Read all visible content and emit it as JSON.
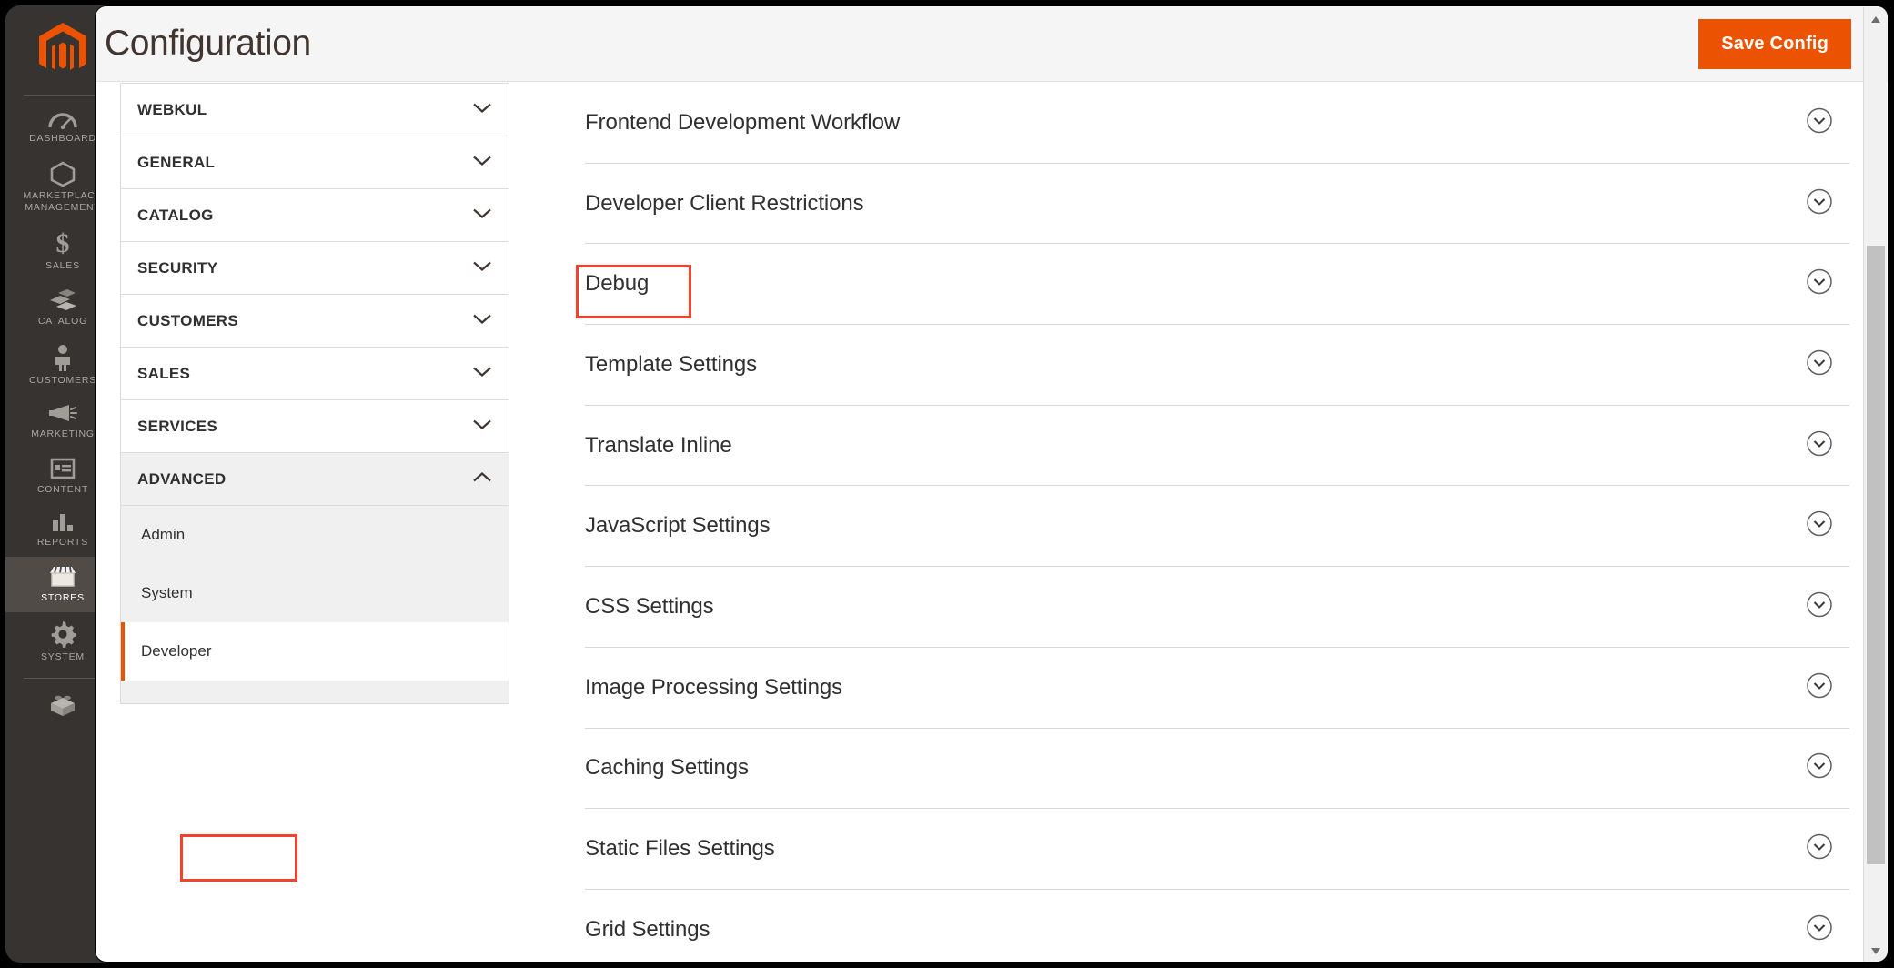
{
  "colors": {
    "brand_orange": "#eb5202",
    "annotation_red": "#f4412e",
    "sidebar_dark": "#373330",
    "sidebar_active": "#514b47",
    "header_bg": "#f5f5f5",
    "text_dark": "#303030"
  },
  "admin_sidebar": {
    "logo_name": "magento-logo",
    "items": [
      {
        "label": "Dashboard",
        "icon": "dashboard-gauge-icon",
        "active": false
      },
      {
        "label": "Marketplace Management",
        "icon": "hexagon-outline-icon",
        "active": false
      },
      {
        "label": "Sales",
        "icon": "dollar-sign-icon",
        "active": false
      },
      {
        "label": "Catalog",
        "icon": "box-stack-icon",
        "active": false
      },
      {
        "label": "Customers",
        "icon": "person-icon",
        "active": false
      },
      {
        "label": "Marketing",
        "icon": "megaphone-icon",
        "active": false
      },
      {
        "label": "Content",
        "icon": "layout-panels-icon",
        "active": false
      },
      {
        "label": "Reports",
        "icon": "bar-chart-icon",
        "active": false
      },
      {
        "label": "Stores",
        "icon": "storefront-awning-icon",
        "active": true
      },
      {
        "label": "System",
        "icon": "gear-icon",
        "active": false
      }
    ],
    "footer_item": {
      "label": "",
      "icon": "lego-brick-icon"
    }
  },
  "header": {
    "title": "Configuration",
    "save_label": "Save Config"
  },
  "config_nav": {
    "sections": [
      {
        "label": "WEBKUL",
        "expanded": false,
        "chevron": "chevron-down-icon"
      },
      {
        "label": "GENERAL",
        "expanded": false,
        "chevron": "chevron-down-icon"
      },
      {
        "label": "CATALOG",
        "expanded": false,
        "chevron": "chevron-down-icon"
      },
      {
        "label": "SECURITY",
        "expanded": false,
        "chevron": "chevron-down-icon"
      },
      {
        "label": "CUSTOMERS",
        "expanded": false,
        "chevron": "chevron-down-icon"
      },
      {
        "label": "SALES",
        "expanded": false,
        "chevron": "chevron-down-icon"
      },
      {
        "label": "SERVICES",
        "expanded": false,
        "chevron": "chevron-down-icon"
      },
      {
        "label": "ADVANCED",
        "expanded": true,
        "chevron": "chevron-up-icon",
        "children": [
          {
            "label": "Admin",
            "active": false
          },
          {
            "label": "System",
            "active": false
          },
          {
            "label": "Developer",
            "active": true,
            "annotated": true
          }
        ]
      }
    ]
  },
  "config_content": {
    "sections": [
      {
        "label": "Frontend Development Workflow",
        "chevron": "chevron-down-circle-icon",
        "annotated": false
      },
      {
        "label": "Developer Client Restrictions",
        "chevron": "chevron-down-circle-icon",
        "annotated": false
      },
      {
        "label": "Debug",
        "chevron": "chevron-down-circle-icon",
        "annotated": true
      },
      {
        "label": "Template Settings",
        "chevron": "chevron-down-circle-icon",
        "annotated": false
      },
      {
        "label": "Translate Inline",
        "chevron": "chevron-down-circle-icon",
        "annotated": false
      },
      {
        "label": "JavaScript Settings",
        "chevron": "chevron-down-circle-icon",
        "annotated": false
      },
      {
        "label": "CSS Settings",
        "chevron": "chevron-down-circle-icon",
        "annotated": false
      },
      {
        "label": "Image Processing Settings",
        "chevron": "chevron-down-circle-icon",
        "annotated": false
      },
      {
        "label": "Caching Settings",
        "chevron": "chevron-down-circle-icon",
        "annotated": false
      },
      {
        "label": "Static Files Settings",
        "chevron": "chevron-down-circle-icon",
        "annotated": false
      },
      {
        "label": "Grid Settings",
        "chevron": "chevron-down-circle-icon",
        "annotated": false
      }
    ]
  },
  "scrollbar": {
    "up_icon": "scroll-up-arrow-icon",
    "down_icon": "scroll-down-arrow-icon",
    "thumb": "scrollbar-thumb"
  }
}
